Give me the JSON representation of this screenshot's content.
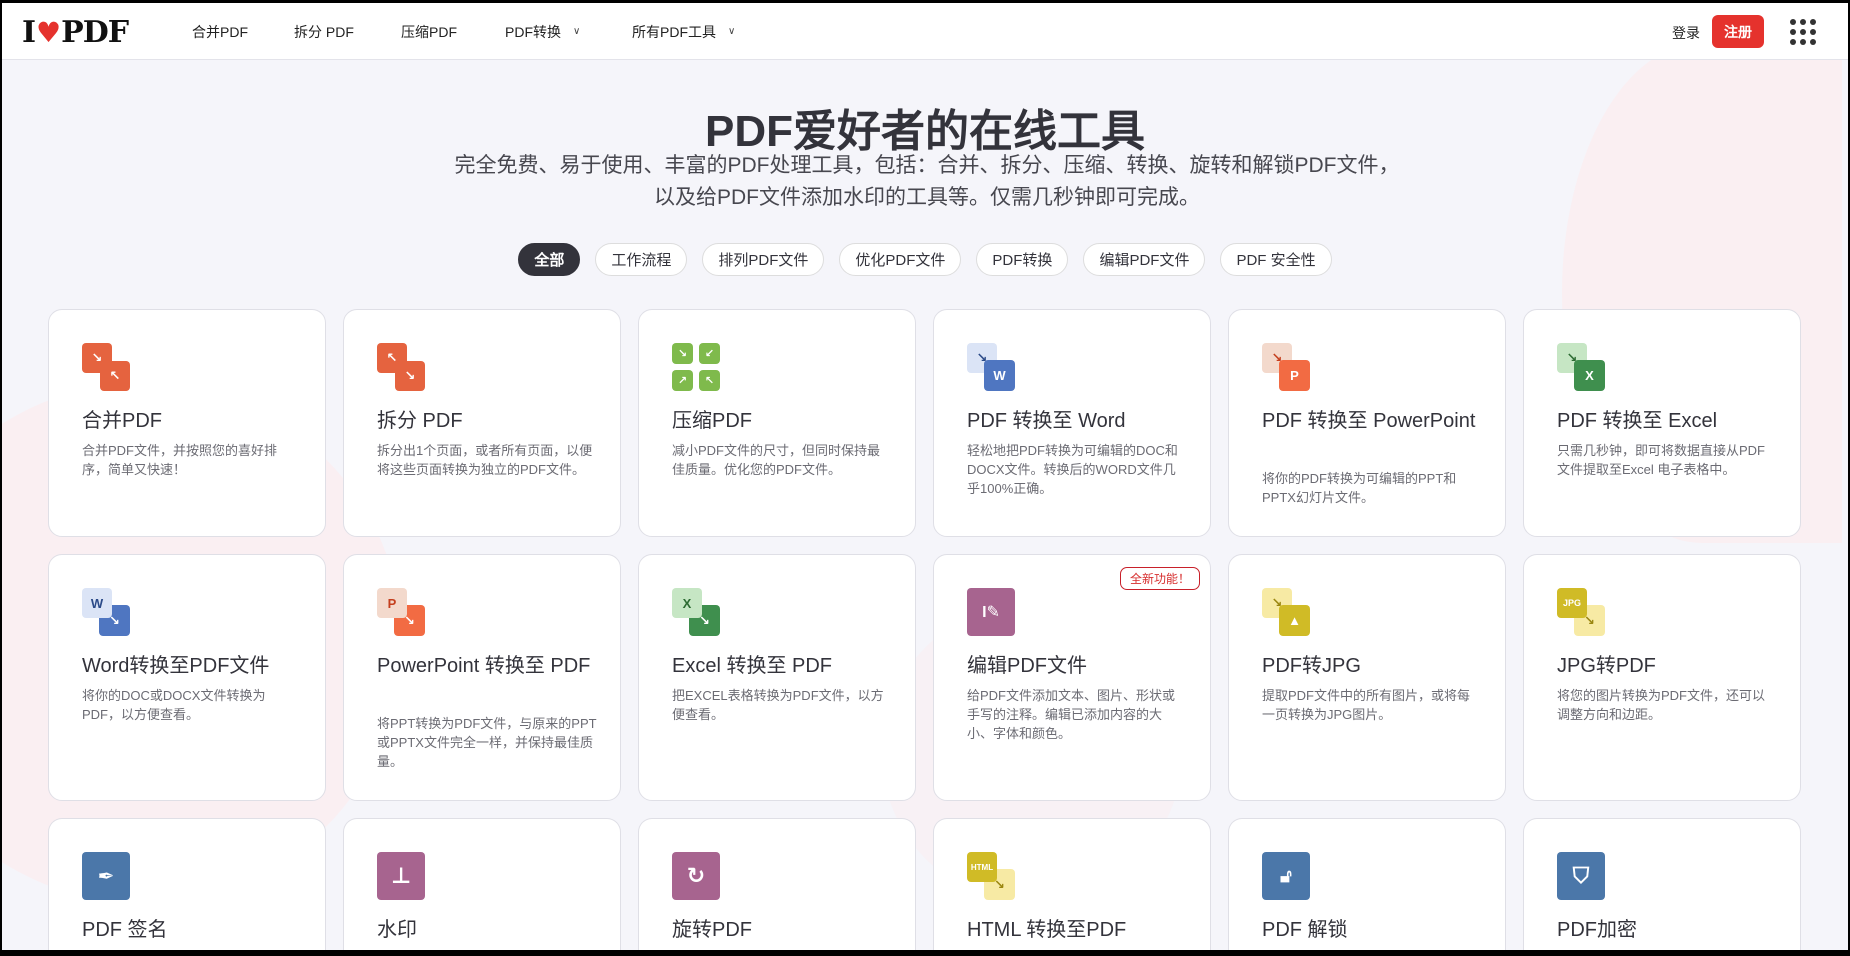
{
  "header": {
    "logo": "I♥PDF",
    "nav": [
      {
        "label": "合并PDF"
      },
      {
        "label": "拆分 PDF"
      },
      {
        "label": "压缩PDF"
      },
      {
        "label": "PDF转换",
        "dropdown": true
      },
      {
        "label": "所有PDF工具",
        "dropdown": true
      }
    ],
    "login": "登录",
    "signup": "注册"
  },
  "hero": {
    "title": "PDF爱好者的在线工具",
    "subtitle": "完全免费、易于使用、丰富的PDF处理工具，包括：合并、拆分、压缩、转换、旋转和解锁PDF文件，以及给PDF文件添加水印的工具等。仅需几秒钟即可完成。"
  },
  "filters": [
    {
      "label": "全部",
      "active": true
    },
    {
      "label": "工作流程"
    },
    {
      "label": "排列PDF文件"
    },
    {
      "label": "优化PDF文件"
    },
    {
      "label": "PDF转换"
    },
    {
      "label": "编辑PDF文件"
    },
    {
      "label": "PDF 安全性"
    }
  ],
  "colors": {
    "accent": "#e5322d",
    "orange": "#e5633f",
    "green": "#7fba4c",
    "word": "#4f76c1",
    "ppt": "#f26b43",
    "excel": "#3f8f4e",
    "purple": "#a7648f",
    "yellow": "#d0bb26",
    "blue": "#4b77a9"
  },
  "tools": [
    {
      "title": "合并PDF",
      "desc": "合并PDF文件，并按照您的喜好排序，简单又快速！",
      "icon": "merge-icon"
    },
    {
      "title": "拆分 PDF",
      "desc": "拆分出1个页面，或者所有页面，以便将这些页面转换为独立的PDF文件。",
      "icon": "split-icon"
    },
    {
      "title": "压缩PDF",
      "desc": "减小PDF文件的尺寸，但同时保持最佳质量。优化您的PDF文件。",
      "icon": "compress-icon"
    },
    {
      "title": "PDF 转换至 Word",
      "desc": "轻松地把PDF转换为可编辑的DOC和DOCX文件。转换后的WORD文件几乎100%正确。",
      "icon": "pdf-to-word-icon"
    },
    {
      "title": "PDF 转换至 PowerPoint",
      "desc": "将你的PDF转换为可编辑的PPT和PPTX幻灯片文件。",
      "icon": "pdf-to-powerpoint-icon"
    },
    {
      "title": "PDF 转换至 Excel",
      "desc": "只需几秒钟，即可将数据直接从PDF文件提取至Excel 电子表格中。",
      "icon": "pdf-to-excel-icon"
    },
    {
      "title": "Word转换至PDF文件",
      "desc": "将你的DOC或DOCX文件转换为PDF，以方便查看。",
      "icon": "word-to-pdf-icon"
    },
    {
      "title": "PowerPoint 转换至 PDF",
      "desc": "将PPT转换为PDF文件，与原来的PPT或PPTX文件完全一样，并保持最佳质量。",
      "icon": "powerpoint-to-pdf-icon"
    },
    {
      "title": "Excel 转换至 PDF",
      "desc": "把EXCEL表格转换为PDF文件，以方便查看。",
      "icon": "excel-to-pdf-icon"
    },
    {
      "title": "编辑PDF文件",
      "desc": "给PDF文件添加文本、图片、形状或手写的注释。编辑已添加内容的大小、字体和颜色。",
      "icon": "edit-pdf-icon",
      "badge": "全新功能！"
    },
    {
      "title": "PDF转JPG",
      "desc": "提取PDF文件中的所有图片，或将每一页转换为JPG图片。",
      "icon": "pdf-to-jpg-icon"
    },
    {
      "title": "JPG转PDF",
      "desc": "将您的图片转换为PDF文件，还可以调整方向和边距。",
      "icon": "jpg-to-pdf-icon"
    },
    {
      "title": "PDF 签名",
      "icon": "sign-pdf-icon"
    },
    {
      "title": "水印",
      "icon": "watermark-icon"
    },
    {
      "title": "旋转PDF",
      "icon": "rotate-pdf-icon"
    },
    {
      "title": "HTML 转换至PDF",
      "icon": "html-to-pdf-icon"
    },
    {
      "title": "PDF 解锁",
      "icon": "unlock-pdf-icon"
    },
    {
      "title": "PDF加密",
      "icon": "protect-pdf-icon"
    }
  ]
}
